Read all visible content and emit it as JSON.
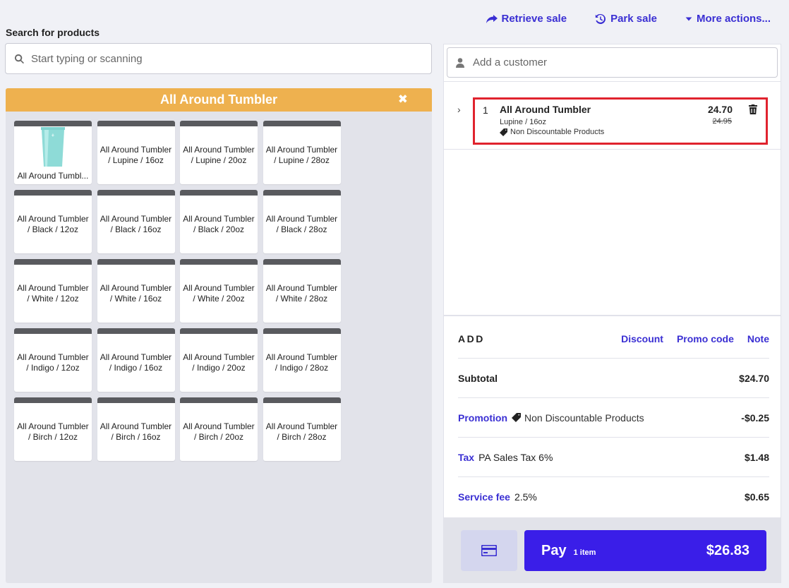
{
  "top_actions": {
    "retrieve": "Retrieve sale",
    "park": "Park sale",
    "more": "More actions..."
  },
  "search": {
    "label": "Search for products",
    "placeholder": "Start typing or scanning"
  },
  "products": {
    "header": "All Around Tumbler",
    "close": "✖",
    "tiles": [
      "All Around Tumbl...",
      "All Around Tumbler / Lupine / 16oz",
      "All Around Tumbler / Lupine / 20oz",
      "All Around Tumbler / Lupine / 28oz",
      "All Around Tumbler / Black / 12oz",
      "All Around Tumbler / Black / 16oz",
      "All Around Tumbler / Black / 20oz",
      "All Around Tumbler / Black / 28oz",
      "All Around Tumbler / White / 12oz",
      "All Around Tumbler / White / 16oz",
      "All Around Tumbler / White / 20oz",
      "All Around Tumbler / White / 28oz",
      "All Around Tumbler / Indigo / 12oz",
      "All Around Tumbler / Indigo / 16oz",
      "All Around Tumbler / Indigo / 20oz",
      "All Around Tumbler / Indigo / 28oz",
      "All Around Tumbler / Birch / 12oz",
      "All Around Tumbler / Birch / 16oz",
      "All Around Tumbler / Birch / 20oz",
      "All Around Tumbler / Birch / 28oz"
    ]
  },
  "customer": {
    "placeholder": "Add a customer"
  },
  "cart": {
    "qty": "1",
    "name": "All Around Tumbler",
    "variant": "Lupine / 16oz",
    "tag": "Non Discountable Products",
    "price": "24.70",
    "old_price": "24.95"
  },
  "summary": {
    "add_label": "ADD",
    "discount": "Discount",
    "promo_code": "Promo code",
    "note": "Note",
    "subtotal_label": "Subtotal",
    "subtotal": "$24.70",
    "promotion_label": "Promotion",
    "promotion_tag": "Non Discountable Products",
    "promotion_value": "-$0.25",
    "tax_label": "Tax",
    "tax_desc": "PA Sales Tax 6%",
    "tax_value": "$1.48",
    "service_label": "Service fee",
    "service_desc": "2.5%",
    "service_value": "$0.65"
  },
  "pay": {
    "label": "Pay",
    "count": "1 item",
    "total": "$26.83"
  },
  "colors": {
    "accent": "#3a2fd3",
    "pay_button": "#3a1ee8",
    "header_orange": "#eeb14f",
    "highlight_red": "#e0232e"
  }
}
